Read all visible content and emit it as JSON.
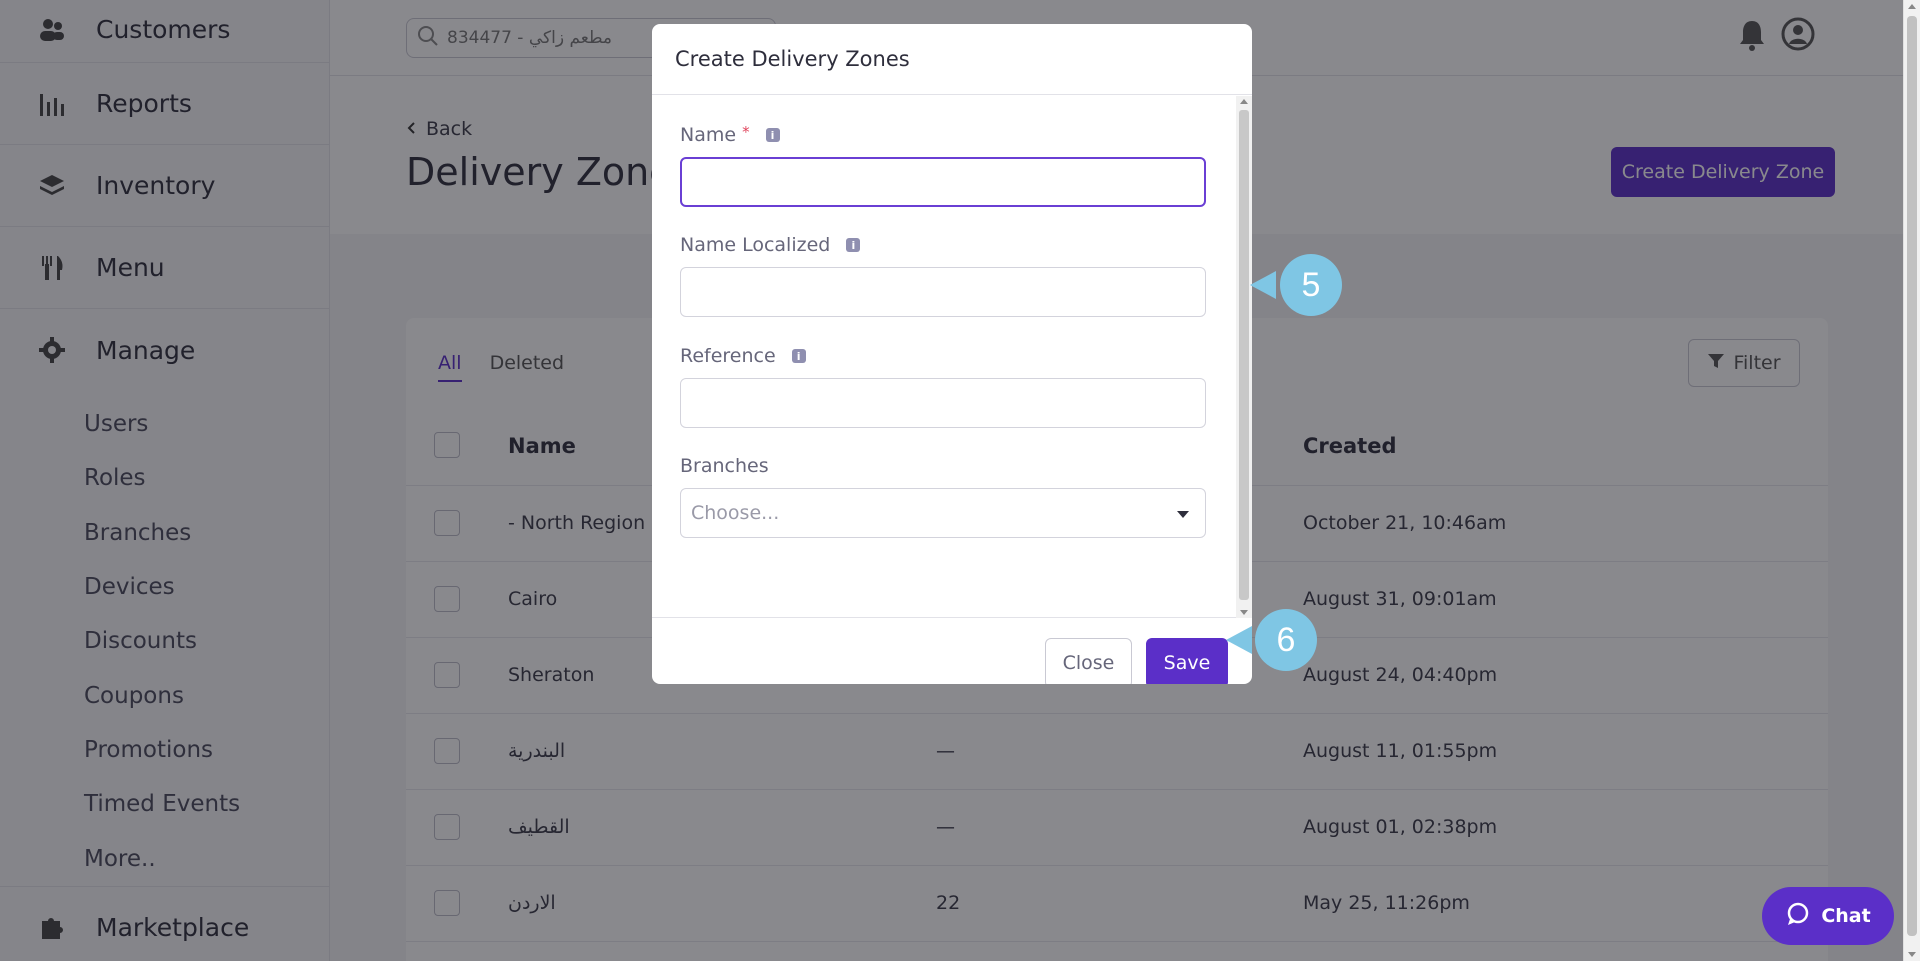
{
  "sidebar": {
    "items": [
      {
        "label": "Customers",
        "icon": "customers-icon"
      },
      {
        "label": "Reports",
        "icon": "reports-icon"
      },
      {
        "label": "Inventory",
        "icon": "inventory-icon"
      },
      {
        "label": "Menu",
        "icon": "menu-icon"
      }
    ],
    "manage": {
      "label": "Manage",
      "icon": "gear-icon",
      "sub_items": [
        "Users",
        "Roles",
        "Branches",
        "Devices",
        "Discounts",
        "Coupons",
        "Promotions",
        "Timed Events",
        "More.."
      ]
    },
    "marketplace": {
      "label": "Marketplace",
      "icon": "puzzle-icon"
    }
  },
  "topbar": {
    "search_text": "834477 - مطعم زاكي"
  },
  "header": {
    "back_label": "Back",
    "title": "Delivery Zones",
    "create_button": "Create Delivery Zone"
  },
  "table": {
    "tabs": [
      {
        "label": "All",
        "active": true
      },
      {
        "label": "Deleted",
        "active": false
      }
    ],
    "filter_label": "Filter",
    "columns": {
      "name": "Name",
      "created": "Created"
    },
    "rows": [
      {
        "name": "- North Region",
        "mid": "",
        "created": "October 21, 10:46am"
      },
      {
        "name": "Cairo",
        "mid": "",
        "created": "August 31, 09:01am"
      },
      {
        "name": "Sheraton",
        "mid": "",
        "created": "August 24, 04:40pm"
      },
      {
        "name": "البندرية",
        "mid": "—",
        "created": "August 11, 01:55pm"
      },
      {
        "name": "القطيف",
        "mid": "—",
        "created": "August 01, 02:38pm"
      },
      {
        "name": "الاردن",
        "mid": "22",
        "created": "May 25, 11:26pm"
      }
    ]
  },
  "modal": {
    "title": "Create Delivery Zones",
    "fields": {
      "name_label": "Name",
      "required_mark": "*",
      "name_localized_label": "Name Localized",
      "reference_label": "Reference",
      "branches_label": "Branches",
      "branches_placeholder": "Choose..."
    },
    "close_label": "Close",
    "save_label": "Save"
  },
  "callouts": {
    "step5": "5",
    "step6": "6"
  },
  "chat": {
    "label": "Chat"
  },
  "colors": {
    "accent": "#5b2fc8",
    "callout": "#7fc6e4"
  }
}
